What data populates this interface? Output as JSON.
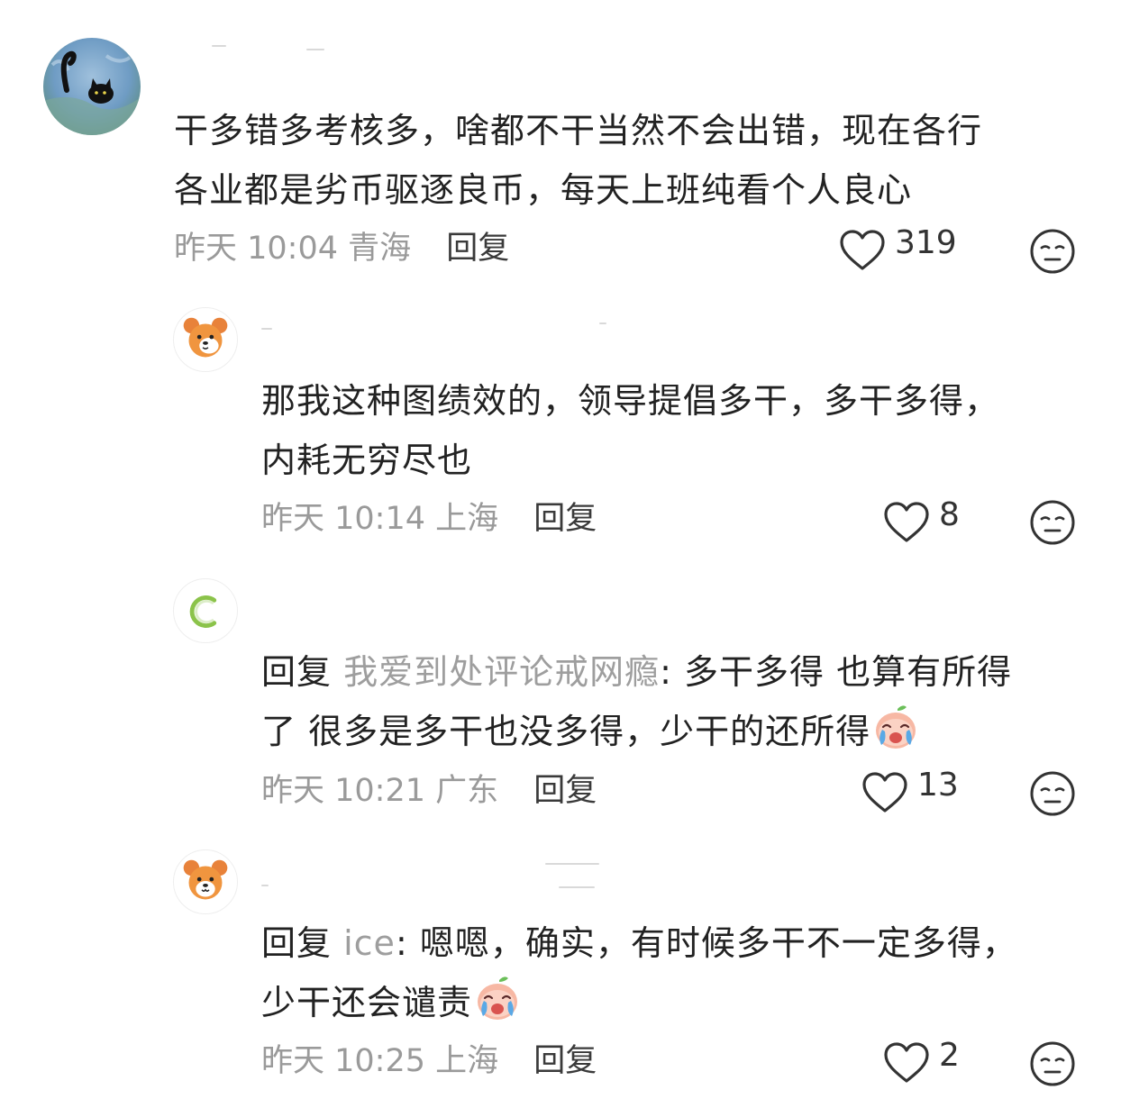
{
  "comments": [
    {
      "lines": [
        "干多错多考核多，啥都不干当然不会出错，现在各行",
        "各业都是劣币驱逐良币，每天上班纯看个人良心"
      ],
      "time": "昨天 10:04",
      "location": "青海",
      "reply_label": "回复",
      "likes": "319"
    }
  ],
  "replies": [
    {
      "lines": [
        "那我这种图绩效的，领导提倡多干，多干多得，",
        "内耗无穷尽也"
      ],
      "time": "昨天 10:14",
      "location": "上海",
      "reply_label": "回复",
      "likes": "8"
    },
    {
      "prefix": "回复",
      "target": "我爱到处评论戒网瘾",
      "line1_rest": ": 多干多得 也算有所得",
      "line2": "了 很多是多干也没多得，少干的还所得",
      "emoji": "crying-peach-emoji",
      "time": "昨天 10:21",
      "location": "广东",
      "reply_label": "回复",
      "likes": "13"
    },
    {
      "prefix": "回复",
      "target": "ice",
      "line1_rest": ": 嗯嗯，确实，有时候多干不一定多得，",
      "line2": "少干还会谴责",
      "emoji": "crying-peach-emoji",
      "time": "昨天 10:25",
      "location": "上海",
      "reply_label": "回复",
      "likes": "2"
    }
  ],
  "icons": {
    "like": "heart-outline-icon",
    "dislike": "neutral-face-icon"
  },
  "colors": {
    "text": "#222222",
    "meta": "#9a9a9a",
    "reply_target": "#9e9e9e"
  }
}
